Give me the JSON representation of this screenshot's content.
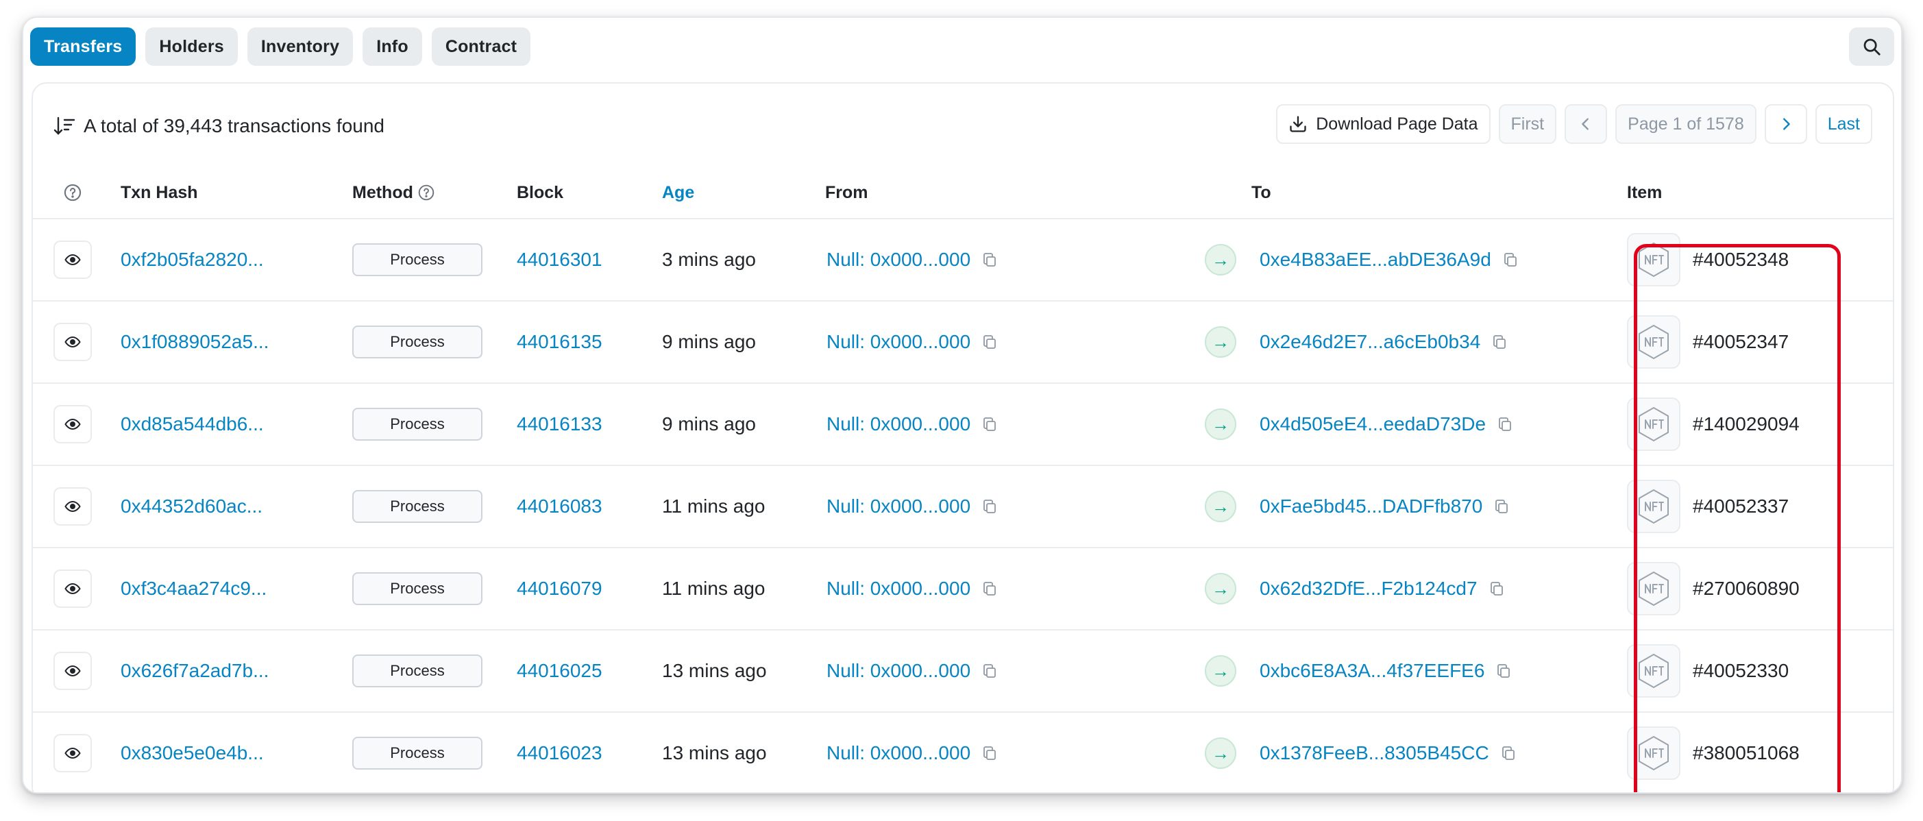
{
  "tabs": [
    {
      "label": "Transfers"
    },
    {
      "label": "Holders"
    },
    {
      "label": "Inventory"
    },
    {
      "label": "Info"
    },
    {
      "label": "Contract"
    }
  ],
  "summary": {
    "text": "A total of 39,443 transactions found"
  },
  "toolbar": {
    "download_label": "Download Page Data",
    "first_label": "First",
    "page_label": "Page 1 of 1578",
    "last_label": "Last"
  },
  "columns": {
    "txn_hash": "Txn Hash",
    "method": "Method",
    "block": "Block",
    "age": "Age",
    "from": "From",
    "to": "To",
    "item": "Item"
  },
  "rows": [
    {
      "hash": "0xf2b05fa2820...",
      "method": "Process",
      "block": "44016301",
      "age": "3 mins ago",
      "from": "Null: 0x000...000",
      "to": "0xe4B83aEE...abDE36A9d",
      "item": "#40052348"
    },
    {
      "hash": "0x1f0889052a5...",
      "method": "Process",
      "block": "44016135",
      "age": "9 mins ago",
      "from": "Null: 0x000...000",
      "to": "0x2e46d2E7...a6cEb0b34",
      "item": "#40052347"
    },
    {
      "hash": "0xd85a544db6...",
      "method": "Process",
      "block": "44016133",
      "age": "9 mins ago",
      "from": "Null: 0x000...000",
      "to": "0x4d505eE4...eedaD73De",
      "item": "#140029094"
    },
    {
      "hash": "0x44352d60ac...",
      "method": "Process",
      "block": "44016083",
      "age": "11 mins ago",
      "from": "Null: 0x000...000",
      "to": "0xFae5bd45...DADFfb870",
      "item": "#40052337"
    },
    {
      "hash": "0xf3c4aa274c9...",
      "method": "Process",
      "block": "44016079",
      "age": "11 mins ago",
      "from": "Null: 0x000...000",
      "to": "0x62d32DfE...F2b124cd7",
      "item": "#270060890"
    },
    {
      "hash": "0x626f7a2ad7b...",
      "method": "Process",
      "block": "44016025",
      "age": "13 mins ago",
      "from": "Null: 0x000...000",
      "to": "0xbc6E8A3A...4f37EEFE6",
      "item": "#40052330"
    },
    {
      "hash": "0x830e5e0e4b...",
      "method": "Process",
      "block": "44016023",
      "age": "13 mins ago",
      "from": "Null: 0x000...000",
      "to": "0x1378FeeB...8305B45CC",
      "item": "#380051068"
    }
  ],
  "colors": {
    "accent": "#0784c3",
    "highlight": "#e3001b",
    "success": "#00a186"
  }
}
